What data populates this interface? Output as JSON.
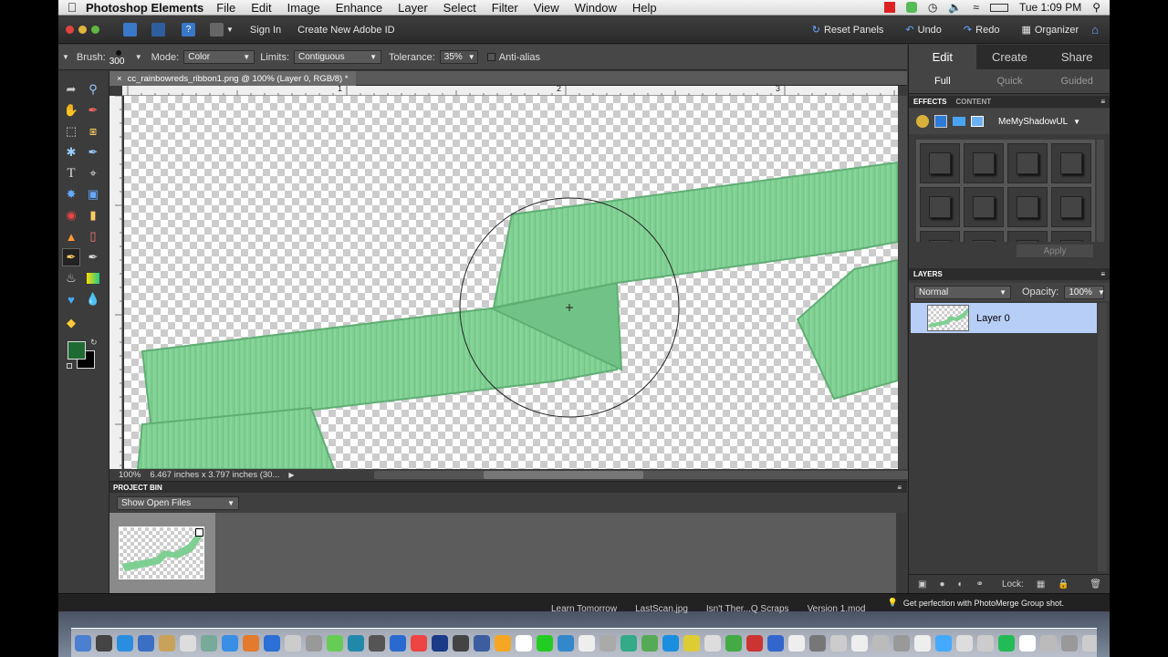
{
  "menubar": {
    "app_name": "Photoshop Elements",
    "items": [
      "File",
      "Edit",
      "Image",
      "Enhance",
      "Layer",
      "Select",
      "Filter",
      "View",
      "Window",
      "Help"
    ],
    "clock": "Tue 1:09 PM"
  },
  "appbar": {
    "sign_in": "Sign In",
    "create_id": "Create New Adobe ID",
    "reset_panels": "Reset Panels",
    "undo": "Undo",
    "redo": "Redo",
    "organizer": "Organizer"
  },
  "options": {
    "brush_label": "Brush:",
    "brush_size": "300",
    "mode_label": "Mode:",
    "mode_value": "Color",
    "limits_label": "Limits:",
    "limits_value": "Contiguous",
    "tolerance_label": "Tolerance:",
    "tolerance_value": "35%",
    "antialias_label": "Anti-alias"
  },
  "document": {
    "tab_title": "cc_rainbowreds_ribbon1.png @ 100% (Layer 0, RGB/8) *",
    "ruler_marks": [
      "1",
      "2",
      "3"
    ],
    "zoom": "100%",
    "doc_info": "6.467 inches x 3.797 inches (30..."
  },
  "project_bin": {
    "header": "PROJECT BIN",
    "select_value": "Show Open Files"
  },
  "panel": {
    "mode_tabs": [
      "Edit",
      "Create",
      "Share"
    ],
    "sub_tabs": [
      "Full",
      "Quick",
      "Guided"
    ],
    "effects_tab": "EFFECTS",
    "content_tab": "CONTENT",
    "effects_select": "MeMyShadowUL",
    "apply": "Apply",
    "layers_header": "LAYERS",
    "blend_mode": "Normal",
    "opacity_label": "Opacity:",
    "opacity_value": "100%",
    "layer_name": "Layer 0",
    "lock_label": "Lock:"
  },
  "status": {
    "tip": "Get perfection with PhotoMerge Group shot."
  },
  "desktop": {
    "labels": [
      "Learn Tomorrow",
      "LastScan.jpg",
      "Isn't Ther...Q Scraps",
      "Version 1.mod"
    ]
  },
  "colors": {
    "ribbon": "#7fcf93",
    "ribbon_dark": "#5fae73",
    "foreground_swatch": "#1d6b33",
    "background_swatch": "#000000",
    "layer_selected": "#b7cef6"
  }
}
